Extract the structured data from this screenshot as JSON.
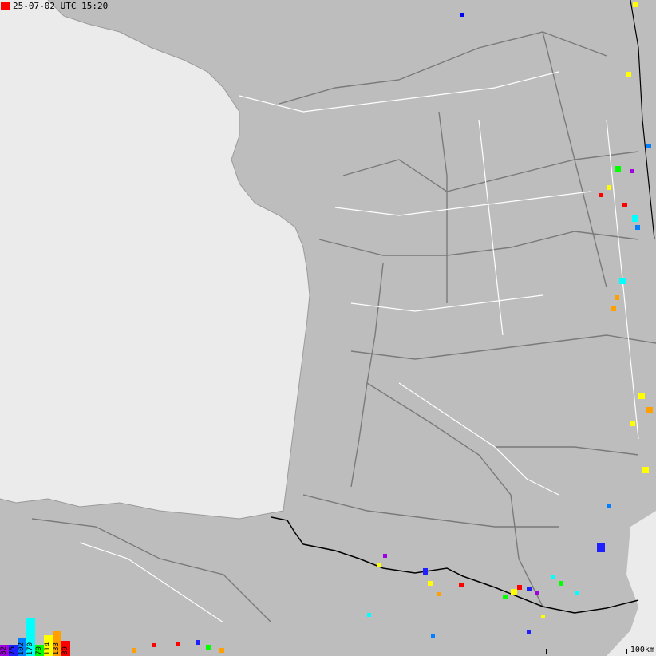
{
  "timestamp": {
    "text": "25-07-02 UTC 15:20",
    "marker_color": "#ff0000"
  },
  "scale": {
    "label": "100km"
  },
  "colors": {
    "sea": "#ebebeb",
    "land": "#bdbdbd",
    "border": "#000000",
    "roads": "#7a7a7a",
    "rivers": "#ffffff"
  },
  "legend": [
    {
      "label": "82",
      "color": "#a000e0",
      "level": 0.3
    },
    {
      "label": "75",
      "color": "#2020ff",
      "level": 0.3
    },
    {
      "label": "102",
      "color": "#0080ff",
      "level": 0.45
    },
    {
      "label": "170",
      "color": "#00ffff",
      "level": 1.0
    },
    {
      "label": "79",
      "color": "#00ff00",
      "level": 0.3
    },
    {
      "label": "114",
      "color": "#ffff00",
      "level": 0.55
    },
    {
      "label": "133",
      "color": "#ffa000",
      "level": 0.65
    },
    {
      "label": "89",
      "color": "#ff0000",
      "level": 0.4
    }
  ]
}
